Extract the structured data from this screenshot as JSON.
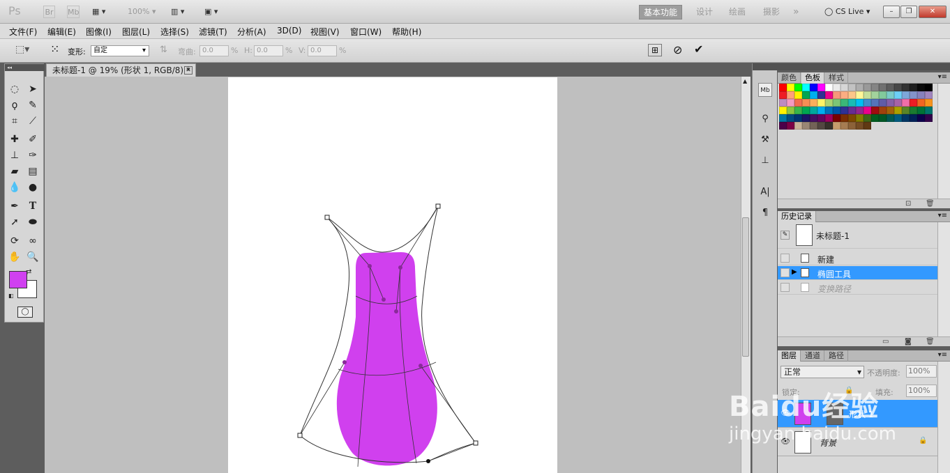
{
  "app": {
    "logo": "Ps",
    "bridge_btn": "Br",
    "minibridge_btn": "Mb",
    "zoom": "100%",
    "workspaces": [
      "基本功能",
      "设计",
      "绘画",
      "摄影"
    ],
    "active_workspace": "基本功能",
    "overflow": "»",
    "cslive": "CS Live",
    "window_controls": [
      "–",
      "❐",
      "✕"
    ]
  },
  "menu": [
    "文件(F)",
    "编辑(E)",
    "图像(I)",
    "图层(L)",
    "选择(S)",
    "滤镜(T)",
    "分析(A)",
    "3D(D)",
    "视图(V)",
    "窗口(W)",
    "帮助(H)"
  ],
  "options": {
    "warp_label": "变形:",
    "warp_value": "自定",
    "bend_label": "弯曲:",
    "bend_value": "0.0",
    "h_label": "H:",
    "h_value": "0.0",
    "v_label": "V:",
    "v_value": "0.0",
    "pct": "%"
  },
  "document": {
    "tab_title": "未标题-1 @ 19% (形状 1, RGB/8) *",
    "close": "✕"
  },
  "colors": {
    "foreground": "#d040f0",
    "background": "#ffffff",
    "shape_fill": "#d040ee",
    "highlight": "#3399ff"
  },
  "panels": {
    "swatch_tabs": [
      "颜色",
      "色板",
      "样式"
    ],
    "active_swatch_tab": "色板",
    "history_tab": "历史记录",
    "history_snapshot": "未标题-1",
    "history_items": [
      "新建",
      "椭圆工具",
      "变换路径"
    ],
    "layers_tabs": [
      "图层",
      "通道",
      "路径"
    ],
    "blend_mode": "正常",
    "opacity_label": "不透明度:",
    "opacity_value": "100%",
    "fill_label": "填充:",
    "fill_value": "100%",
    "lock_label": "锁定:",
    "layer_names": [
      "形状 1",
      "背景"
    ]
  },
  "watermark": {
    "line1": "Baidu经验",
    "line2": "jingyan.baidu.com"
  }
}
